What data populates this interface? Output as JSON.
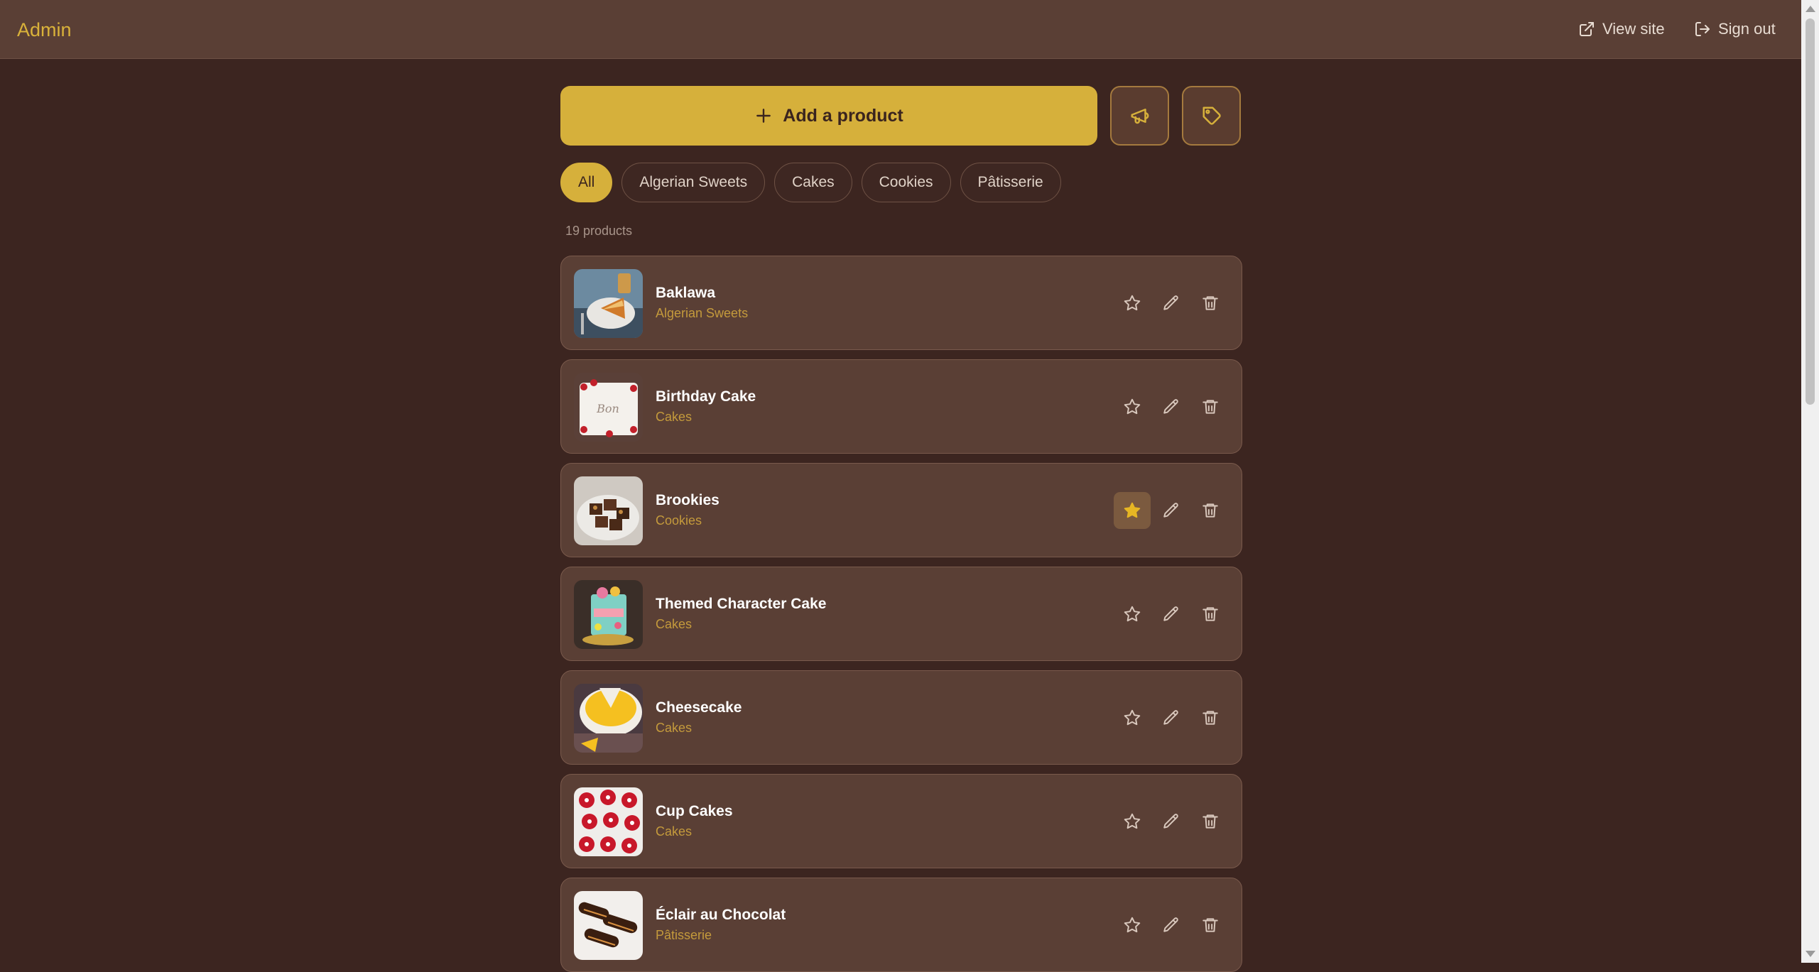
{
  "header": {
    "brand": "Admin",
    "view_site": "View site",
    "sign_out": "Sign out"
  },
  "toolbar": {
    "add_product": "Add a product",
    "announce_icon": "megaphone-icon",
    "tag_icon": "tag-icon"
  },
  "filters": [
    {
      "label": "All",
      "active": true
    },
    {
      "label": "Algerian Sweets",
      "active": false
    },
    {
      "label": "Cakes",
      "active": false
    },
    {
      "label": "Cookies",
      "active": false
    },
    {
      "label": "Pâtisserie",
      "active": false
    }
  ],
  "product_count": "19 products",
  "products": [
    {
      "name": "Baklawa",
      "category": "Algerian Sweets",
      "featured": false
    },
    {
      "name": "Birthday Cake",
      "category": "Cakes",
      "featured": false
    },
    {
      "name": "Brookies",
      "category": "Cookies",
      "featured": true
    },
    {
      "name": "Themed Character Cake",
      "category": "Cakes",
      "featured": false
    },
    {
      "name": "Cheesecake",
      "category": "Cakes",
      "featured": false
    },
    {
      "name": "Cup Cakes",
      "category": "Cakes",
      "featured": false
    },
    {
      "name": "Éclair au Chocolat",
      "category": "Pâtisserie",
      "featured": false
    }
  ],
  "colors": {
    "accent": "#d6b03b",
    "background": "#3c2520",
    "card": "#5a3f35",
    "category_text": "#c49a3c"
  }
}
